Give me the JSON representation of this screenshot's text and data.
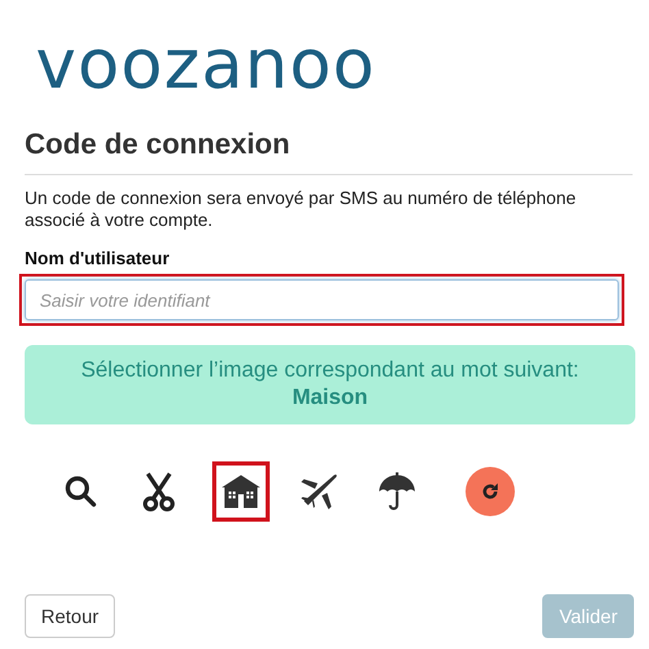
{
  "logo": {
    "text": "voozanoo"
  },
  "heading": "Code de connexion",
  "intro": "Un code de connexion sera envoyé par SMS au numéro de téléphone associé à votre compte.",
  "username": {
    "label": "Nom d'utilisateur",
    "placeholder": "Saisir votre identifiant",
    "highlighted": true
  },
  "challenge": {
    "prompt": "Sélectionner l’image correspondant au mot suivant:",
    "word": "Maison"
  },
  "images": [
    {
      "kind": "search",
      "selected": false
    },
    {
      "kind": "scissors",
      "selected": false
    },
    {
      "kind": "house",
      "selected": true
    },
    {
      "kind": "plane",
      "selected": false
    },
    {
      "kind": "umbrella",
      "selected": false
    }
  ],
  "buttons": [
    {
      "label": "Retour",
      "kind": "secondary",
      "disabled": false
    },
    {
      "label": "Valider",
      "kind": "primary",
      "disabled": true
    }
  ]
}
